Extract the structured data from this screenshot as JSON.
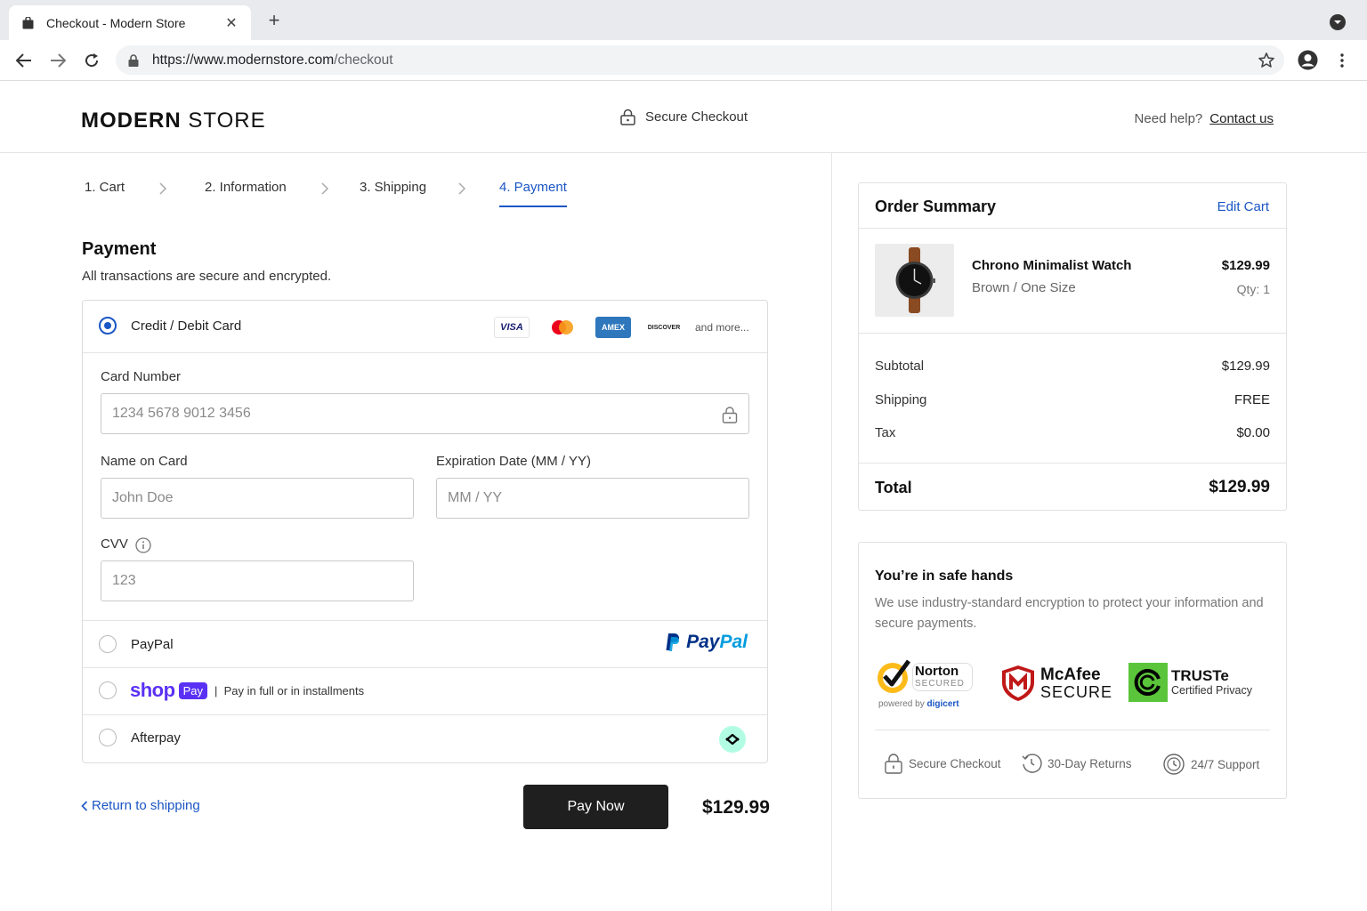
{
  "browser": {
    "tab_title": "Checkout - Modern Store",
    "url_host": "https://www.modernstore.com",
    "url_path": "/checkout"
  },
  "header": {
    "logo_bold": "MODERN",
    "logo_light": " STORE",
    "secure_label": "Secure Checkout",
    "help_text": "Need help?",
    "contact_link": "Contact us"
  },
  "steps": [
    {
      "label": "1. Cart",
      "active": false
    },
    {
      "label": "2. Information",
      "active": false
    },
    {
      "label": "3. Shipping",
      "active": false
    },
    {
      "label": "4. Payment",
      "active": true
    }
  ],
  "payment": {
    "title": "Payment",
    "subtitle": "All transactions are secure and encrypted.",
    "card_option_label": "Credit / Debit Card",
    "card_brands": [
      "VISA",
      "mastercard",
      "AMEX",
      "DISCOVER"
    ],
    "and_more": "and more...",
    "card_number_label": "Card Number",
    "card_number_placeholder": "1234 5678 9012 3456",
    "name_label": "Name on Card",
    "name_placeholder": "John Doe",
    "expiry_label": "Expiration Date (MM / YY)",
    "expiry_placeholder": "MM / YY",
    "cvv_label": "CVV",
    "cvv_placeholder": "123",
    "paypal_label": "PayPal",
    "paypal_logo_p1": "Pay",
    "paypal_logo_p2": "Pal",
    "shoppay_word": "shop",
    "shoppay_badge": "Pay",
    "shoppay_text": "Pay in full or in installments",
    "afterpay_label": "Afterpay",
    "return_link": "Return to shipping",
    "pay_button": "Pay Now",
    "total": "$129.99"
  },
  "summary": {
    "title": "Order Summary",
    "edit_cart": "Edit Cart",
    "product_name": "Chrono Minimalist Watch",
    "product_variant": "Brown  /  One Size",
    "product_price": "$129.99",
    "product_qty": "Qty: 1",
    "subtotal_label": "Subtotal",
    "subtotal_value": "$129.99",
    "shipping_label": "Shipping",
    "shipping_value": "FREE",
    "tax_label": "Tax",
    "tax_value": "$0.00",
    "total_label": "Total",
    "total_value": "$129.99"
  },
  "safe": {
    "title": "You’re in safe hands",
    "description": "We use industry-standard encryption to protect your information and secure payments.",
    "norton_1": "Norton",
    "norton_2": "SECURED",
    "norton_3": "powered by",
    "norton_4": "digicert",
    "mcafee_1": "McAfee",
    "mcafee_2": "SECURE",
    "truste_1": "TRUSTe",
    "truste_2": "Certified Privacy",
    "features": [
      "Secure Checkout",
      "30-Day Returns",
      "24/7 Support"
    ]
  },
  "colors": {
    "accent": "#1a56c4",
    "button": "#1f1f1f",
    "shop_pay": "#5a31f4",
    "afterpay": "#b2fce4"
  }
}
